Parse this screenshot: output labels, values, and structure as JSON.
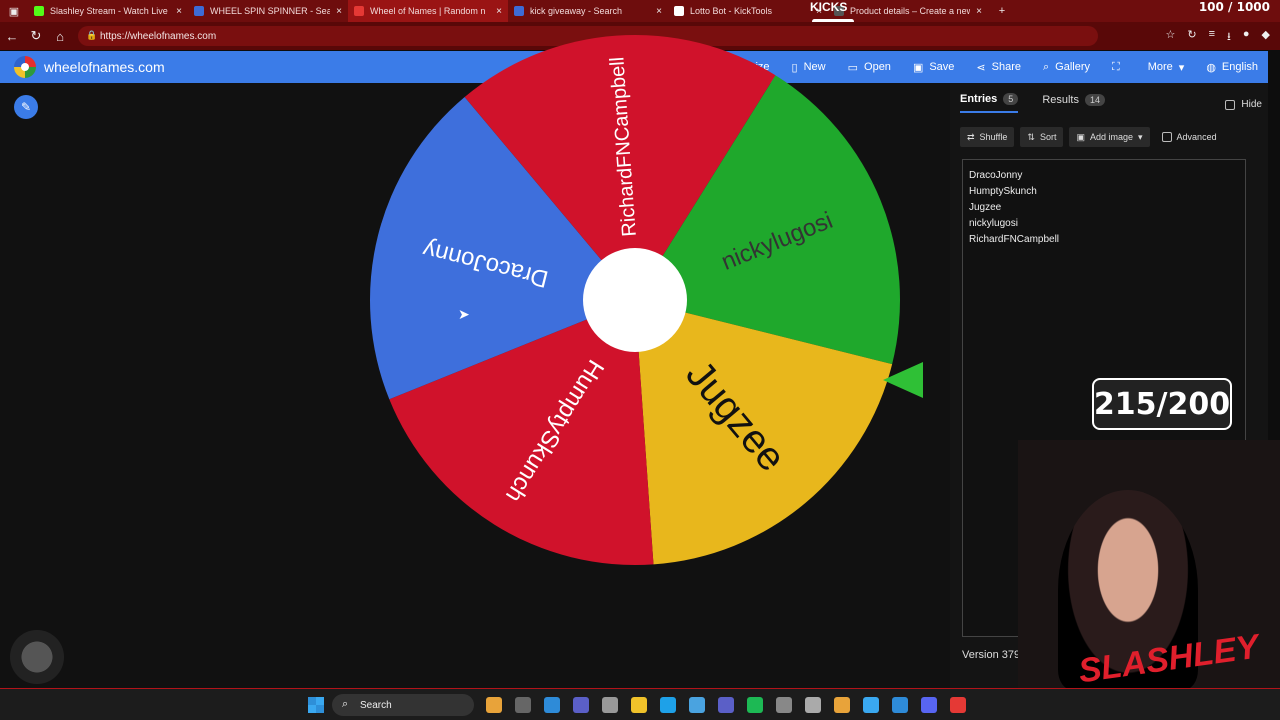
{
  "browser": {
    "tabs": [
      {
        "label": "Slashley Stream - Watch Live",
        "color": "#53fc18"
      },
      {
        "label": "WHEEL SPIN SPINNER - Search",
        "color": "#3d6bd6"
      },
      {
        "label": "Wheel of Names | Random n",
        "color": "#e53935"
      },
      {
        "label": "kick giveaway - Search",
        "color": "#3d6bd6"
      },
      {
        "label": "Lotto Bot - KickTools",
        "color": "#ffffff"
      },
      {
        "label": "Product details – Create a new pr",
        "color": "#555555"
      }
    ],
    "counter": "100 / 1000",
    "kicks_label": "KICKS",
    "url": "https://wheelofnames.com"
  },
  "app": {
    "site_name": "wheelofnames.com",
    "menu": [
      {
        "label": "Customize",
        "icon": "palette-icon"
      },
      {
        "label": "New",
        "icon": "file-icon"
      },
      {
        "label": "Open",
        "icon": "folder-icon"
      },
      {
        "label": "Save",
        "icon": "save-icon"
      },
      {
        "label": "Share",
        "icon": "share-icon"
      },
      {
        "label": "Gallery",
        "icon": "search-icon"
      },
      {
        "label": "",
        "icon": "fullscreen-icon"
      },
      {
        "label": "More",
        "icon": "chevron-down-icon"
      },
      {
        "label": "English",
        "icon": "globe-icon"
      }
    ]
  },
  "wheel": {
    "segments": [
      {
        "name": "nickylugosi",
        "color": "#1fa82c",
        "text_color": "#333333"
      },
      {
        "name": "Jugzee",
        "color": "#e8b71c",
        "text_color": "#111111"
      },
      {
        "name": "HumptySkunch",
        "color": "#d0122b",
        "text_color": "#ffffff"
      },
      {
        "name": "DracoJonny",
        "color": "#3e6fdc",
        "text_color": "#ffffff"
      },
      {
        "name": "RichardFNCampbell",
        "color": "#d0122b",
        "text_color": "#ffffff"
      }
    ]
  },
  "panel": {
    "tabs": {
      "entries_label": "Entries",
      "entries_count": "5",
      "results_label": "Results",
      "results_count": "14"
    },
    "hide_label": "Hide",
    "toolbar": {
      "shuffle": "Shuffle",
      "sort": "Sort",
      "add_image": "Add image",
      "advanced": "Advanced"
    },
    "entries": [
      "DracoJonny",
      "HumptySkunch",
      "Jugzee",
      "nickylugosi",
      "RichardFNCampbell"
    ],
    "version": "Version 379"
  },
  "overlay": {
    "counter": "215/200",
    "brand": "SLASHLEY"
  },
  "taskbar": {
    "search_label": "Search",
    "icon_colors": [
      "#e8a33a",
      "#666666",
      "#2e8bd8",
      "#5b5fc7",
      "#999999",
      "#f0c22a",
      "#1ea1e8",
      "#4aa3e0",
      "#5b5fc7",
      "#1db954",
      "#888888",
      "#aaaaaa",
      "#e8a33a",
      "#3aa8f0",
      "#2e8bd8",
      "#5865f2",
      "#e53935"
    ]
  }
}
